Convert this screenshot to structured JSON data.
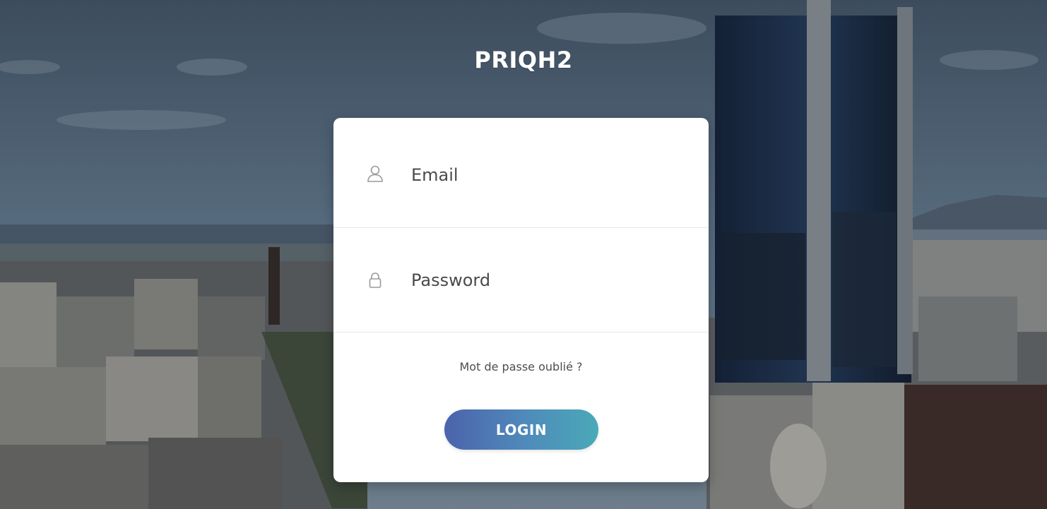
{
  "app": {
    "brand_title": "PRIQH2"
  },
  "login_form": {
    "email": {
      "placeholder": "Email",
      "value": "",
      "icon": "user-icon"
    },
    "password": {
      "placeholder": "Password",
      "value": "",
      "icon": "lock-icon"
    },
    "forgot_password_label": "Mot de passe oublié ?",
    "login_button_label": "LOGIN"
  },
  "colors": {
    "card_background": "#ffffff",
    "button_gradient_start": "#4c63ab",
    "button_gradient_end": "#4aa9b8",
    "brand_text": "#ffffff"
  }
}
